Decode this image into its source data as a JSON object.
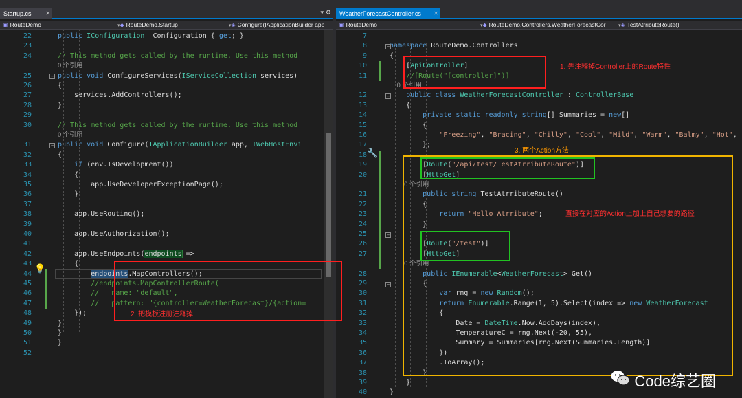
{
  "left": {
    "tab": "Startup.cs",
    "nav": [
      "RouteDemo",
      "RouteDemo.Startup",
      "Configure(IApplicationBuilder app"
    ],
    "lines": [
      {
        "n": "22",
        "c": [
          [
            "kw",
            "public "
          ],
          [
            "ty",
            "IConfiguration"
          ],
          [
            "",
            "  Configuration { "
          ],
          [
            "kw",
            "get"
          ],
          [
            "",
            "; }"
          ]
        ]
      },
      {
        "n": "23",
        "c": []
      },
      {
        "n": "24",
        "c": [
          [
            "cm",
            "// This method gets called by the runtime. Use this method"
          ]
        ]
      },
      {
        "n": "",
        "c": [
          [
            "ref",
            "0 个引用"
          ]
        ]
      },
      {
        "n": "25",
        "c": [
          [
            "kw",
            "public void "
          ],
          [
            "",
            "ConfigureServices("
          ],
          [
            "ty",
            "IServiceCollection"
          ],
          [
            "",
            " services)"
          ]
        ]
      },
      {
        "n": "26",
        "c": [
          [
            "",
            "{"
          ]
        ]
      },
      {
        "n": "27",
        "c": [
          [
            "",
            "    services.AddControllers();"
          ]
        ]
      },
      {
        "n": "28",
        "c": [
          [
            "",
            "}"
          ]
        ]
      },
      {
        "n": "29",
        "c": []
      },
      {
        "n": "30",
        "c": [
          [
            "cm",
            "// This method gets called by the runtime. Use this method"
          ]
        ]
      },
      {
        "n": "",
        "c": [
          [
            "ref",
            "0 个引用"
          ]
        ]
      },
      {
        "n": "31",
        "c": [
          [
            "kw",
            "public void "
          ],
          [
            "",
            "Configure("
          ],
          [
            "ty",
            "IApplicationBuilder"
          ],
          [
            "",
            " app, "
          ],
          [
            "ty",
            "IWebHostEnvi"
          ]
        ]
      },
      {
        "n": "32",
        "c": [
          [
            "",
            "{"
          ]
        ]
      },
      {
        "n": "33",
        "c": [
          [
            "",
            "    "
          ],
          [
            "kw",
            "if "
          ],
          [
            "",
            "(env.IsDevelopment())"
          ]
        ]
      },
      {
        "n": "34",
        "c": [
          [
            "",
            "    {"
          ]
        ]
      },
      {
        "n": "35",
        "c": [
          [
            "",
            "        app.UseDeveloperExceptionPage();"
          ]
        ]
      },
      {
        "n": "36",
        "c": [
          [
            "",
            "    }"
          ]
        ]
      },
      {
        "n": "37",
        "c": []
      },
      {
        "n": "38",
        "c": [
          [
            "",
            "    app.UseRouting();"
          ]
        ]
      },
      {
        "n": "39",
        "c": []
      },
      {
        "n": "40",
        "c": [
          [
            "",
            "    app.UseAuthorization();"
          ]
        ]
      },
      {
        "n": "41",
        "c": []
      },
      {
        "n": "42",
        "c": [
          [
            "",
            "    app.UseEndpoints("
          ],
          [
            "hl",
            "endpoints"
          ],
          [
            "",
            " =>"
          ]
        ]
      },
      {
        "n": "43",
        "c": [
          [
            "",
            "    {"
          ]
        ]
      },
      {
        "n": "44",
        "c": [
          [
            "",
            "        "
          ],
          [
            "cur",
            "endpoints"
          ],
          [
            "",
            ".MapControllers();"
          ]
        ]
      },
      {
        "n": "45",
        "c": [
          [
            "cm",
            "        //endpoints.MapControllerRoute("
          ]
        ]
      },
      {
        "n": "46",
        "c": [
          [
            "cm",
            "        //   name: \"default\","
          ]
        ]
      },
      {
        "n": "47",
        "c": [
          [
            "cm",
            "        //   pattern: \"{controller=WeatherForecast}/{action="
          ]
        ]
      },
      {
        "n": "48",
        "c": [
          [
            "",
            "    });"
          ]
        ]
      },
      {
        "n": "49",
        "c": [
          [
            "",
            "}"
          ]
        ]
      },
      {
        "n": "50",
        "c": [
          [
            "",
            "}"
          ]
        ]
      },
      {
        "n": "51",
        "c": [
          [
            "",
            "}"
          ]
        ]
      },
      {
        "n": "52",
        "c": []
      }
    ],
    "note2": "2. 把模板注册注释掉"
  },
  "right": {
    "tab": "WeatherForecastController.cs",
    "nav": [
      "RouteDemo",
      "RouteDemo.Controllers.WeatherForecastCor",
      "TestAtrributeRoute()"
    ],
    "lines": [
      {
        "n": "7",
        "c": []
      },
      {
        "n": "8",
        "c": [
          [
            "kw",
            "namespace "
          ],
          [
            "",
            "RouteDemo.Controllers"
          ]
        ]
      },
      {
        "n": "9",
        "c": [
          [
            "",
            "{"
          ]
        ]
      },
      {
        "n": "10",
        "c": [
          [
            "",
            "    ["
          ],
          [
            "ty",
            "ApiController"
          ],
          [
            "",
            "]"
          ]
        ]
      },
      {
        "n": "11",
        "c": [
          [
            "cm",
            "    //[Route(\"[controller]\")]"
          ]
        ]
      },
      {
        "n": "",
        "c": [
          [
            "ref",
            "    0 个引用"
          ]
        ]
      },
      {
        "n": "12",
        "c": [
          [
            "kw",
            "    public class "
          ],
          [
            "ty",
            "WeatherForecastController"
          ],
          [
            "",
            " : "
          ],
          [
            "ty",
            "ControllerBase"
          ]
        ]
      },
      {
        "n": "13",
        "c": [
          [
            "",
            "    {"
          ]
        ]
      },
      {
        "n": "14",
        "c": [
          [
            "kw",
            "        private static readonly string"
          ],
          [
            "",
            "[] Summaries = "
          ],
          [
            "kw",
            "new"
          ],
          [
            "",
            "[]"
          ]
        ]
      },
      {
        "n": "15",
        "c": [
          [
            "",
            "        {"
          ]
        ]
      },
      {
        "n": "16",
        "c": [
          [
            "",
            "            "
          ],
          [
            "str",
            "\"Freezing\""
          ],
          [
            "",
            ", "
          ],
          [
            "str",
            "\"Bracing\""
          ],
          [
            "",
            ", "
          ],
          [
            "str",
            "\"Chilly\""
          ],
          [
            "",
            ", "
          ],
          [
            "str",
            "\"Cool\""
          ],
          [
            "",
            ", "
          ],
          [
            "str",
            "\"Mild\""
          ],
          [
            "",
            ", "
          ],
          [
            "str",
            "\"Warm\""
          ],
          [
            "",
            ", "
          ],
          [
            "str",
            "\"Balmy\""
          ],
          [
            "",
            ", "
          ],
          [
            "str",
            "\"Hot\""
          ],
          [
            "",
            ", "
          ],
          [
            "str",
            "\"Sw"
          ]
        ]
      },
      {
        "n": "17",
        "c": [
          [
            "",
            "        };"
          ]
        ]
      },
      {
        "n": "18",
        "c": []
      },
      {
        "n": "19",
        "c": [
          [
            "",
            "        ["
          ],
          [
            "ty",
            "Route"
          ],
          [
            "",
            "("
          ],
          [
            "str",
            "\"/api/test/TestAtrributeRoute\""
          ],
          [
            "",
            ")]"
          ]
        ]
      },
      {
        "n": "20",
        "c": [
          [
            "",
            "        ["
          ],
          [
            "ty",
            "HttpGet"
          ],
          [
            "",
            "]"
          ]
        ]
      },
      {
        "n": "",
        "c": [
          [
            "ref",
            "        0 个引用"
          ]
        ]
      },
      {
        "n": "21",
        "c": [
          [
            "kw",
            "        public string "
          ],
          [
            "",
            "TestAtrributeRoute()"
          ]
        ]
      },
      {
        "n": "22",
        "c": [
          [
            "",
            "        {"
          ]
        ]
      },
      {
        "n": "23",
        "c": [
          [
            "kw",
            "            return "
          ],
          [
            "str",
            "\"Hello Atrribute\""
          ],
          [
            "",
            ";"
          ]
        ]
      },
      {
        "n": "24",
        "c": [
          [
            "",
            "        }"
          ]
        ]
      },
      {
        "n": "25",
        "c": []
      },
      {
        "n": "26",
        "c": [
          [
            "",
            "        ["
          ],
          [
            "ty",
            "Route"
          ],
          [
            "",
            "("
          ],
          [
            "str",
            "\"/test\""
          ],
          [
            "",
            ")]"
          ]
        ]
      },
      {
        "n": "27",
        "c": [
          [
            "",
            "        ["
          ],
          [
            "ty",
            "HttpGet"
          ],
          [
            "",
            "]"
          ]
        ]
      },
      {
        "n": "",
        "c": [
          [
            "ref",
            "        0 个引用"
          ]
        ]
      },
      {
        "n": "28",
        "c": [
          [
            "kw",
            "        public "
          ],
          [
            "ty",
            "IEnumerable"
          ],
          [
            "",
            "<"
          ],
          [
            "ty",
            "WeatherForecast"
          ],
          [
            "",
            "> Get()"
          ]
        ]
      },
      {
        "n": "29",
        "c": [
          [
            "",
            "        {"
          ]
        ]
      },
      {
        "n": "30",
        "c": [
          [
            "kw",
            "            var "
          ],
          [
            "",
            "rng = "
          ],
          [
            "kw",
            "new "
          ],
          [
            "ty",
            "Random"
          ],
          [
            "",
            "();"
          ]
        ]
      },
      {
        "n": "31",
        "c": [
          [
            "kw",
            "            return "
          ],
          [
            "ty",
            "Enumerable"
          ],
          [
            "",
            ".Range(1, 5).Select(index => "
          ],
          [
            "kw",
            "new "
          ],
          [
            "ty",
            "WeatherForecast"
          ]
        ]
      },
      {
        "n": "32",
        "c": [
          [
            "",
            "            {"
          ]
        ]
      },
      {
        "n": "33",
        "c": [
          [
            "",
            "                Date = "
          ],
          [
            "ty",
            "DateTime"
          ],
          [
            "",
            ".Now.AddDays(index),"
          ]
        ]
      },
      {
        "n": "34",
        "c": [
          [
            "",
            "                TemperatureC = rng.Next(-20, 55),"
          ]
        ]
      },
      {
        "n": "35",
        "c": [
          [
            "",
            "                Summary = Summaries[rng.Next(Summaries.Length)]"
          ]
        ]
      },
      {
        "n": "36",
        "c": [
          [
            "",
            "            })"
          ]
        ]
      },
      {
        "n": "37",
        "c": [
          [
            "",
            "            .ToArray();"
          ]
        ]
      },
      {
        "n": "38",
        "c": [
          [
            "",
            "        }"
          ]
        ]
      },
      {
        "n": "39",
        "c": [
          [
            "",
            "    }"
          ]
        ]
      },
      {
        "n": "40",
        "c": [
          [
            "",
            "}"
          ]
        ]
      }
    ],
    "note1": "1. 先注释掉Controller上的Route特性",
    "note3": "3. 两个Action方法",
    "note4": "直接在对应的Action上加上自己想要的路径"
  },
  "watermark": "Code综艺圈"
}
